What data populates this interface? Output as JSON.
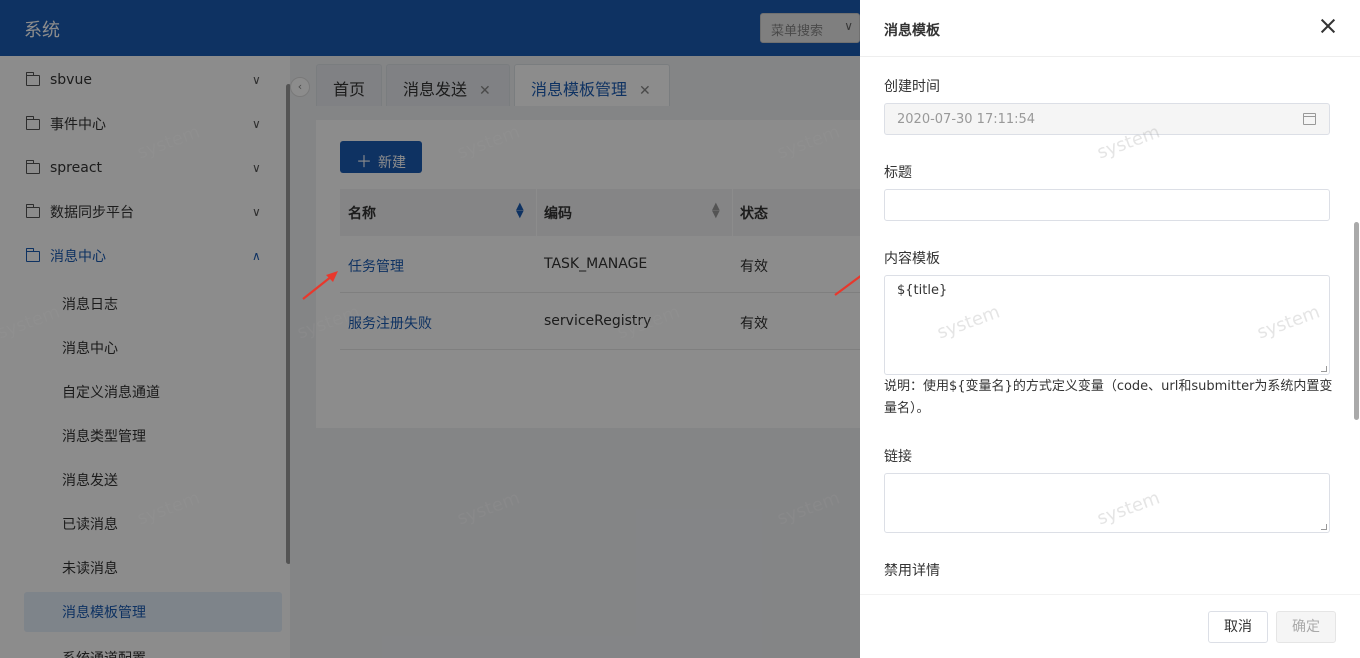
{
  "header": {
    "title": "系统",
    "menu_search_placeholder": "菜单搜索"
  },
  "sidebar": {
    "groups": [
      {
        "label": "sbvue"
      },
      {
        "label": "事件中心"
      },
      {
        "label": "spreact"
      },
      {
        "label": "数据同步平台"
      },
      {
        "label": "消息中心"
      }
    ],
    "sub_items": [
      {
        "label": "消息日志"
      },
      {
        "label": "消息中心"
      },
      {
        "label": "自定义消息通道"
      },
      {
        "label": "消息类型管理"
      },
      {
        "label": "消息发送"
      },
      {
        "label": "已读消息"
      },
      {
        "label": "未读消息"
      },
      {
        "label": "消息模板管理"
      },
      {
        "label": "系统通道配置"
      }
    ]
  },
  "tabs": [
    {
      "label": "首页"
    },
    {
      "label": "消息发送"
    },
    {
      "label": "消息模板管理"
    }
  ],
  "main": {
    "new_button": "新建",
    "table": {
      "columns": [
        "名称",
        "编码",
        "状态"
      ],
      "rows": [
        {
          "name": "任务管理",
          "code": "TASK_MANAGE",
          "status": "有效"
        },
        {
          "name": "服务注册失败",
          "code": "serviceRegistry",
          "status": "有效"
        }
      ]
    }
  },
  "drawer": {
    "title": "消息模板",
    "fields": {
      "created_time_label": "创建时间",
      "created_time_value": "2020-07-30 17:11:54",
      "title_label": "标题",
      "title_value": "",
      "content_label": "内容模板",
      "content_value": "${title}",
      "note": "说明：使用${变量名}的方式定义变量（code、url和submitter为系统内置变量名）。",
      "link_label": "链接",
      "link_value": "",
      "disable_detail_label": "禁用详情"
    },
    "cancel_button": "取消",
    "ok_button": "确定"
  },
  "watermark": "system",
  "colors": {
    "primary": "#1a5bb3",
    "arrow": "#e8382c"
  }
}
